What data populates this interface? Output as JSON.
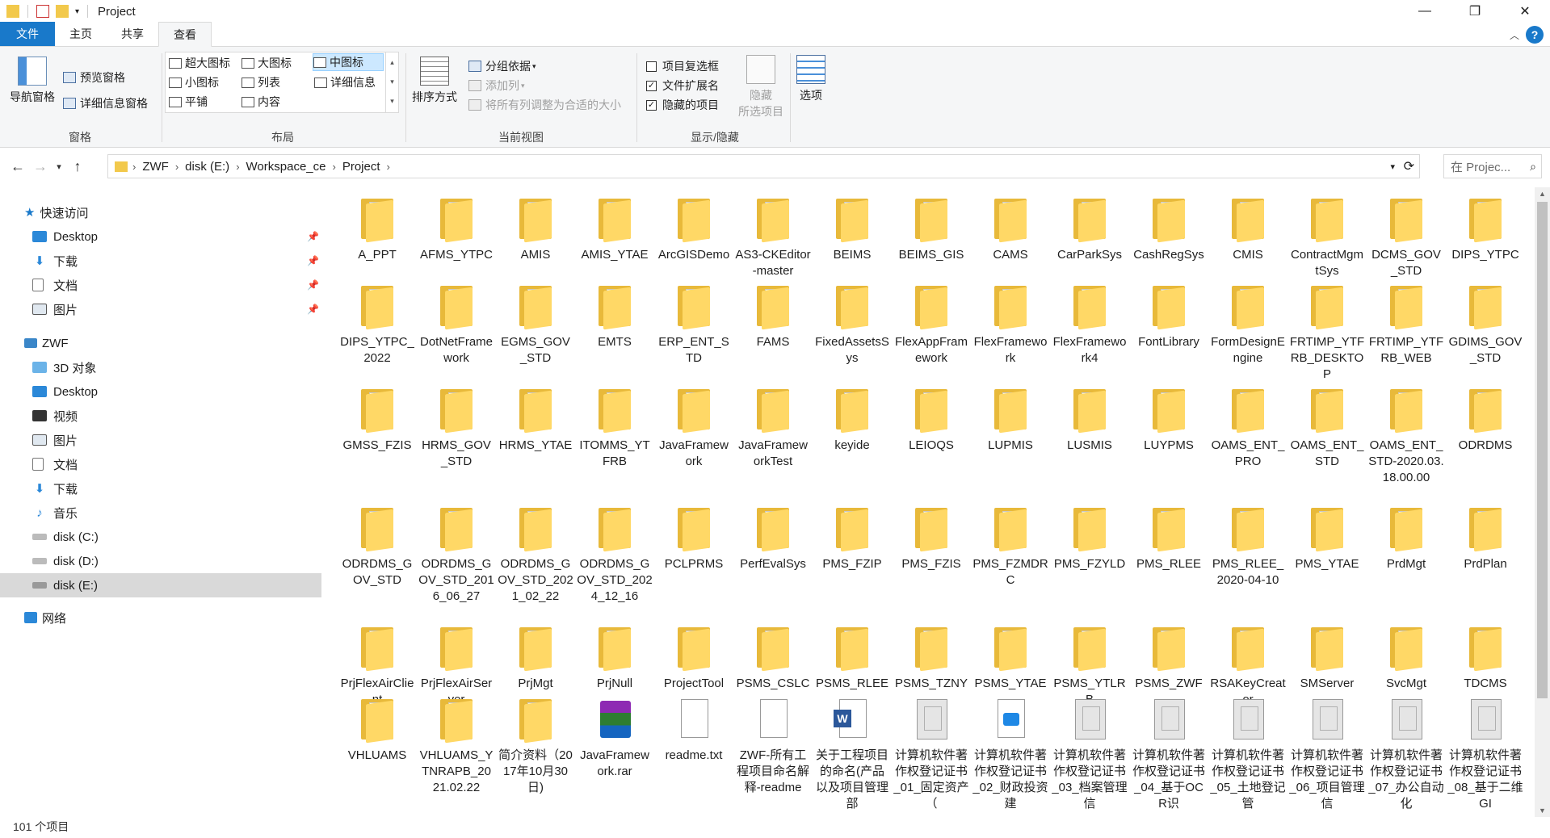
{
  "window": {
    "title": "Project"
  },
  "tabs": [
    "文件",
    "主页",
    "共享",
    "查看"
  ],
  "ribbon": {
    "pane_group": {
      "title": "窗格",
      "nav_pane": "导航窗格",
      "preview": "预览窗格",
      "details": "详细信息窗格"
    },
    "layout_group": {
      "title": "布局",
      "options": [
        "超大图标",
        "大图标",
        "中图标",
        "小图标",
        "列表",
        "详细信息",
        "平铺",
        "内容"
      ],
      "selected": "中图标"
    },
    "view_group": {
      "title": "当前视图",
      "sort": "排序方式",
      "group_by": "分组依据",
      "add_column": "添加列",
      "fit_columns": "将所有列调整为合适的大小"
    },
    "showhide_group": {
      "title": "显示/隐藏",
      "item_checkboxes": "项目复选框",
      "file_ext": "文件扩展名",
      "hidden_items": "隐藏的项目",
      "hide_selected_1": "隐藏",
      "hide_selected_2": "所选项目",
      "options": "选项"
    }
  },
  "address": {
    "crumbs": [
      "ZWF",
      "disk (E:)",
      "Workspace_ce",
      "Project"
    ],
    "search_placeholder": "在 Projec..."
  },
  "nav": {
    "quick_access": "快速访问",
    "quick_items": [
      "Desktop",
      "下载",
      "文档",
      "图片"
    ],
    "pc": "ZWF",
    "pc_items": [
      "3D 对象",
      "Desktop",
      "视频",
      "图片",
      "文档",
      "下载",
      "音乐",
      "disk (C:)",
      "disk (D:)",
      "disk (E:)"
    ],
    "network": "网络"
  },
  "items": [
    {
      "n": "A_PPT",
      "t": "folder"
    },
    {
      "n": "AFMS_YTPC",
      "t": "folder"
    },
    {
      "n": "AMIS",
      "t": "folder"
    },
    {
      "n": "AMIS_YTAE",
      "t": "folder"
    },
    {
      "n": "ArcGISDemo",
      "t": "folder"
    },
    {
      "n": "AS3-CKEditor-master",
      "t": "folder"
    },
    {
      "n": "BEIMS",
      "t": "folder"
    },
    {
      "n": "BEIMS_GIS",
      "t": "folder"
    },
    {
      "n": "CAMS",
      "t": "folder"
    },
    {
      "n": "CarParkSys",
      "t": "folder"
    },
    {
      "n": "CashRegSys",
      "t": "folder"
    },
    {
      "n": "CMIS",
      "t": "folder"
    },
    {
      "n": "ContractMgmtSys",
      "t": "folder"
    },
    {
      "n": "DCMS_GOV_STD",
      "t": "folder"
    },
    {
      "n": "DIPS_YTPC",
      "t": "folder"
    },
    {
      "n": "DIPS_YTPC_2022",
      "t": "folder"
    },
    {
      "n": "DotNetFramework",
      "t": "folder"
    },
    {
      "n": "EGMS_GOV_STD",
      "t": "folder"
    },
    {
      "n": "EMTS",
      "t": "folder"
    },
    {
      "n": "ERP_ENT_STD",
      "t": "folder"
    },
    {
      "n": "FAMS",
      "t": "folder"
    },
    {
      "n": "FixedAssetsSys",
      "t": "folder"
    },
    {
      "n": "FlexAppFramework",
      "t": "folder"
    },
    {
      "n": "FlexFramework",
      "t": "folder"
    },
    {
      "n": "FlexFramework4",
      "t": "folder"
    },
    {
      "n": "FontLibrary",
      "t": "folder"
    },
    {
      "n": "FormDesignEngine",
      "t": "folder"
    },
    {
      "n": "FRTIMP_YTFRB_DESKTOP",
      "t": "folder"
    },
    {
      "n": "FRTIMP_YTFRB_WEB",
      "t": "folder"
    },
    {
      "n": "GDIMS_GOV_STD",
      "t": "folder"
    },
    {
      "n": "GMSS_FZIS",
      "t": "folder"
    },
    {
      "n": "HRMS_GOV_STD",
      "t": "folder"
    },
    {
      "n": "HRMS_YTAE",
      "t": "folder"
    },
    {
      "n": "ITOMMS_YTFRB",
      "t": "folder"
    },
    {
      "n": "JavaFramework",
      "t": "folder"
    },
    {
      "n": "JavaFrameworkTest",
      "t": "folder"
    },
    {
      "n": "keyide",
      "t": "folder"
    },
    {
      "n": "LEIOQS",
      "t": "folder"
    },
    {
      "n": "LUPMIS",
      "t": "folder"
    },
    {
      "n": "LUSMIS",
      "t": "folder"
    },
    {
      "n": "LUYPMS",
      "t": "folder"
    },
    {
      "n": "OAMS_ENT_PRO",
      "t": "folder"
    },
    {
      "n": "OAMS_ENT_STD",
      "t": "folder"
    },
    {
      "n": "OAMS_ENT_STD-2020.03.18.00.00",
      "t": "folder"
    },
    {
      "n": "ODRDMS",
      "t": "folder"
    },
    {
      "n": "ODRDMS_GOV_STD",
      "t": "folder"
    },
    {
      "n": "ODRDMS_GOV_STD_2016_06_27",
      "t": "folder"
    },
    {
      "n": "ODRDMS_GOV_STD_2021_02_22",
      "t": "folder"
    },
    {
      "n": "ODRDMS_GOV_STD_2024_12_16",
      "t": "folder"
    },
    {
      "n": "PCLPRMS",
      "t": "folder"
    },
    {
      "n": "PerfEvalSys",
      "t": "folder"
    },
    {
      "n": "PMS_FZIP",
      "t": "folder"
    },
    {
      "n": "PMS_FZIS",
      "t": "folder"
    },
    {
      "n": "PMS_FZMDRC",
      "t": "folder"
    },
    {
      "n": "PMS_FZYLD",
      "t": "folder"
    },
    {
      "n": "PMS_RLEE",
      "t": "folder"
    },
    {
      "n": "PMS_RLEE_2020-04-10",
      "t": "folder"
    },
    {
      "n": "PMS_YTAE",
      "t": "folder"
    },
    {
      "n": "PrdMgt",
      "t": "folder"
    },
    {
      "n": "PrdPlan",
      "t": "folder"
    },
    {
      "n": "PrjFlexAirClient",
      "t": "folder"
    },
    {
      "n": "PrjFlexAirServer",
      "t": "folder"
    },
    {
      "n": "PrjMgt",
      "t": "folder"
    },
    {
      "n": "PrjNull",
      "t": "folder"
    },
    {
      "n": "ProjectTool",
      "t": "folder"
    },
    {
      "n": "PSMS_CSLC",
      "t": "folder"
    },
    {
      "n": "PSMS_RLEE",
      "t": "folder"
    },
    {
      "n": "PSMS_TZNY",
      "t": "folder"
    },
    {
      "n": "PSMS_YTAE",
      "t": "folder"
    },
    {
      "n": "PSMS_YTLRB",
      "t": "folder"
    },
    {
      "n": "PSMS_ZWF",
      "t": "folder"
    },
    {
      "n": "RSAKeyCreator",
      "t": "folder"
    },
    {
      "n": "SMServer",
      "t": "folder"
    },
    {
      "n": "SvcMgt",
      "t": "folder"
    },
    {
      "n": "TDCMS",
      "t": "folder"
    },
    {
      "n": "VHLUAMS",
      "t": "folder"
    },
    {
      "n": "VHLUAMS_YTNRAPB_2021.02.22",
      "t": "folder"
    },
    {
      "n": "简介资料（2017年10月30日)",
      "t": "folder"
    },
    {
      "n": "JavaFramework.rar",
      "t": "rar"
    },
    {
      "n": "readme.txt",
      "t": "doc"
    },
    {
      "n": "ZWF-所有工程项目命名解释-readme",
      "t": "doc"
    },
    {
      "n": "关于工程项目的命名(产品以及项目管理部",
      "t": "word"
    },
    {
      "n": "计算机软件著作权登记证书_01_固定资产（",
      "t": "cert"
    },
    {
      "n": "计算机软件著作权登记证书_02_财政投资建",
      "t": "img"
    },
    {
      "n": "计算机软件著作权登记证书_03_档案管理信",
      "t": "cert"
    },
    {
      "n": "计算机软件著作权登记证书_04_基于OCR识",
      "t": "cert"
    },
    {
      "n": "计算机软件著作权登记证书_05_土地登记管",
      "t": "cert"
    },
    {
      "n": "计算机软件著作权登记证书_06_项目管理信",
      "t": "cert"
    },
    {
      "n": "计算机软件著作权登记证书_07_办公自动化",
      "t": "cert"
    },
    {
      "n": "计算机软件著作权登记证书_08_基于二维GI",
      "t": "cert"
    }
  ],
  "status": {
    "count": "101 个项目"
  },
  "colors": {
    "accent": "#1979ca",
    "folder": "#ffd866",
    "selection": "#cce8ff"
  }
}
